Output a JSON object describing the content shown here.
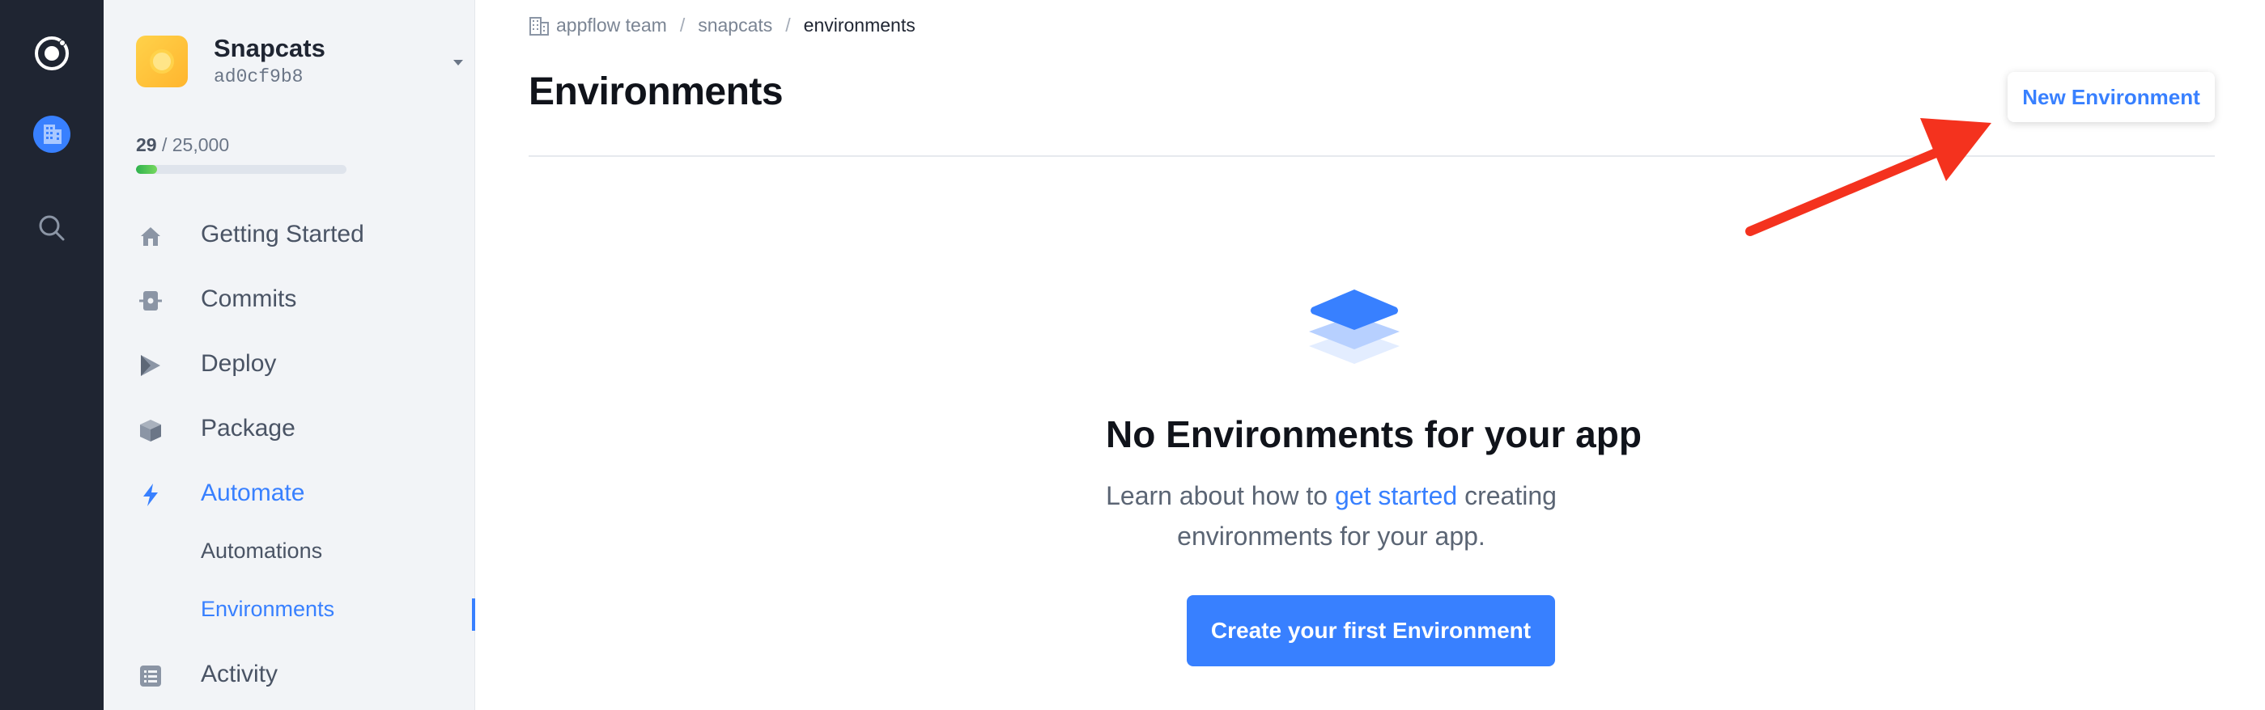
{
  "app": {
    "name": "Snapcats",
    "id": "ad0cf9b8"
  },
  "usage": {
    "used": "29",
    "total": " / 25,000",
    "fraction": 0.1
  },
  "nav": {
    "items": [
      {
        "label": "Getting Started",
        "icon": "home-icon"
      },
      {
        "label": "Commits",
        "icon": "commit-icon"
      },
      {
        "label": "Deploy",
        "icon": "deploy-icon"
      },
      {
        "label": "Package",
        "icon": "package-icon"
      },
      {
        "label": "Automate",
        "icon": "lightning-icon"
      },
      {
        "label": "Activity",
        "icon": "activity-list-icon"
      }
    ],
    "sub_items": [
      {
        "label": "Automations"
      },
      {
        "label": "Environments"
      }
    ]
  },
  "breadcrumb": {
    "items": [
      "appflow team",
      "snapcats",
      "environments"
    ],
    "separator": "/"
  },
  "page": {
    "title": "Environments",
    "new_button": "New Environment"
  },
  "empty_state": {
    "title": "No Environments for your app",
    "desc_before": "Learn about how to ",
    "desc_link": "get started",
    "desc_after": " creating environments for your app.",
    "cta": "Create your first Environment"
  },
  "colors": {
    "accent": "#3880ff",
    "rail": "#1f2532",
    "annotation_arrow": "#f4321e"
  }
}
